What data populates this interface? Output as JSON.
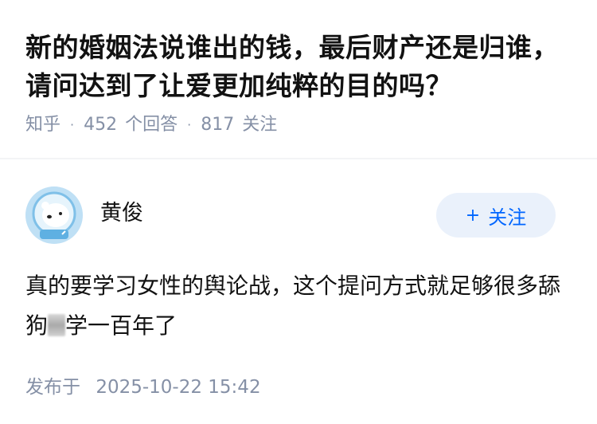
{
  "question": {
    "title": "新的婚姻法说谁出的钱，最后财产还是归谁，请问达到了让爱更加纯粹的目的吗？",
    "source": "知乎",
    "separator": "·",
    "answers_count": "452",
    "answers_label": "个回答",
    "followers_count": "817",
    "followers_label": "关注"
  },
  "answer": {
    "author_name": "黄俊",
    "follow_button": {
      "icon": "plus-icon",
      "plus": "+",
      "label": "关注"
    },
    "text_part1": "真的要学习女性的舆论战，这个提问方式就足够很多舔狗",
    "text_part2": "学一百年了",
    "publish_label": "发布于",
    "publish_time": "2025-10-22 15:42"
  },
  "colors": {
    "text": "#121212",
    "meta": "#8590a6",
    "accent": "#0066ff",
    "follow_bg": "#eaf1fb",
    "avatar_bg": "#cfe6f7"
  }
}
